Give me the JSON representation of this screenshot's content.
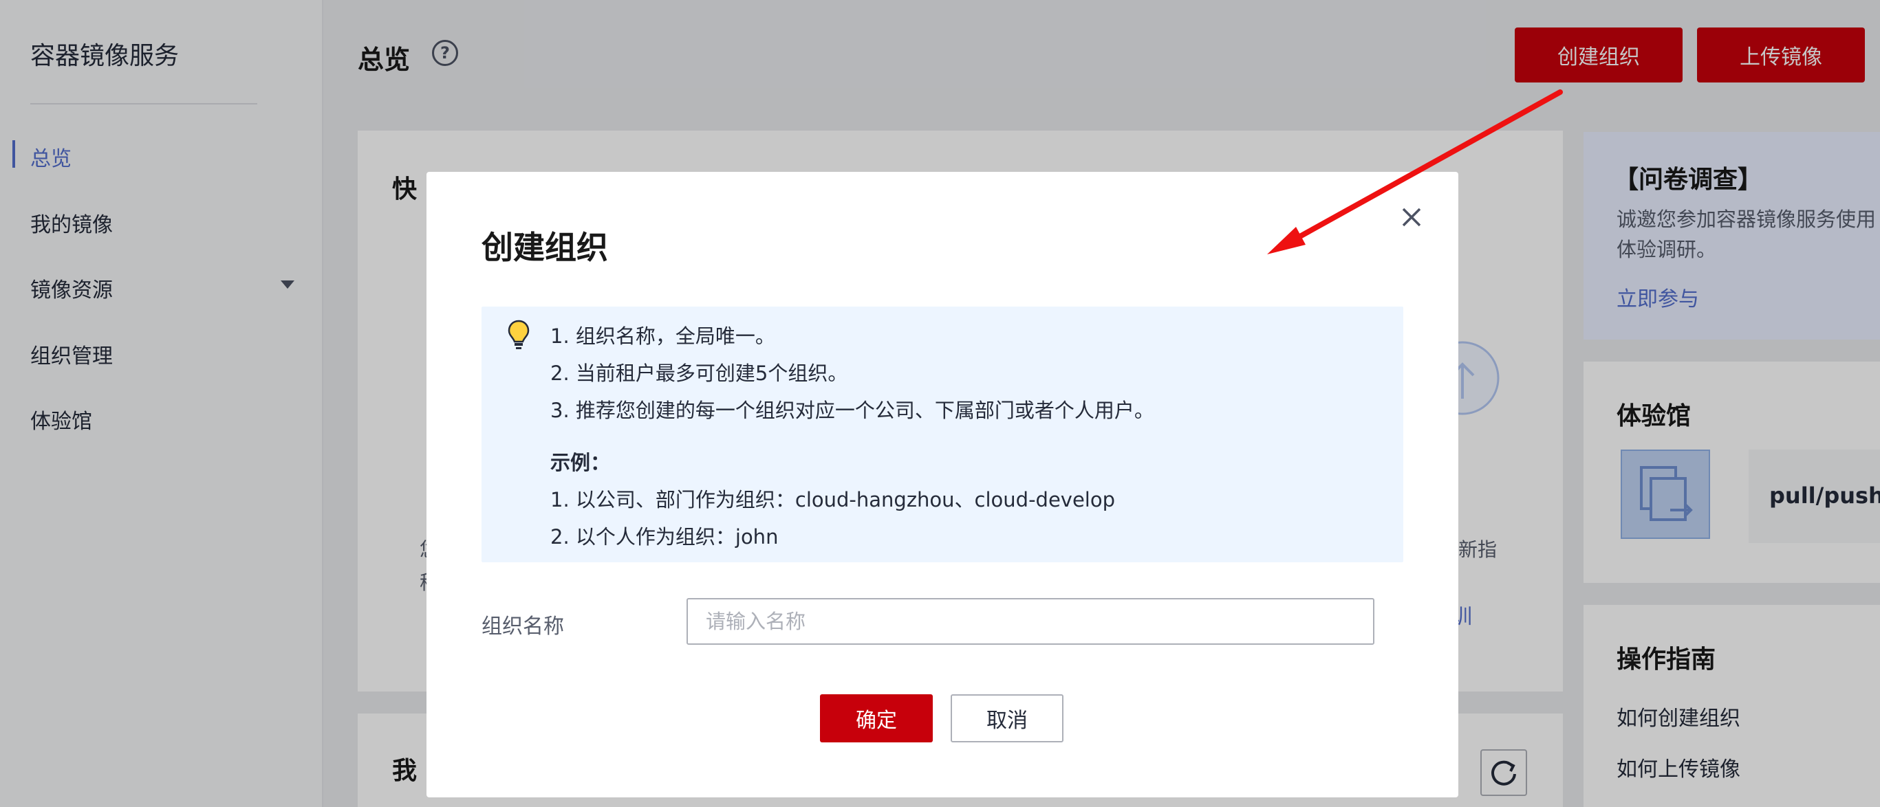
{
  "sidebar": {
    "brand": "容器镜像服务",
    "items": [
      {
        "label": "总览"
      },
      {
        "label": "我的镜像"
      },
      {
        "label": "镜像资源"
      },
      {
        "label": "组织管理"
      },
      {
        "label": "体验馆"
      }
    ]
  },
  "header": {
    "title": "总览",
    "help_glyph": "?",
    "create_org_label": "创建组织",
    "upload_image_label": "上传镜像"
  },
  "background": {
    "quick_title_partial": "快",
    "my_section_partial": "我",
    "left_cut_text_1": "您",
    "left_cut_text_2": "移",
    "right_cut_text": "更新指",
    "right_cut_link": "训",
    "survey": {
      "title": "【问卷调查】",
      "text_line1": "诚邀您参加容器镜像服务使用",
      "text_line2": "体验调研。",
      "link": "立即参与"
    },
    "experience": {
      "title": "体验馆",
      "card_label": "pull/push"
    },
    "guide": {
      "title": "操作指南",
      "items": [
        "如何创建组织",
        "如何上传镜像"
      ]
    }
  },
  "modal": {
    "title": "创建组织",
    "tips": {
      "lines": [
        "1. 组织名称，全局唯一。",
        "2. 当前租户最多可创建5个组织。",
        "3. 推荐您创建的每一个组织对应一个公司、下属部门或者个人用户。"
      ],
      "example_title": "示例：",
      "examples": [
        "1. 以公司、部门作为组织：cloud-hangzhou、cloud-develop",
        "2. 以个人作为组织：john"
      ]
    },
    "field": {
      "label": "组织名称",
      "placeholder": "请输入名称",
      "value": ""
    },
    "confirm_label": "确定",
    "cancel_label": "取消"
  },
  "colors": {
    "brand_red": "#c7000b",
    "link_blue": "#526ecc",
    "tip_bg": "#edf5ff",
    "annotation_arrow": "#ee1111"
  }
}
